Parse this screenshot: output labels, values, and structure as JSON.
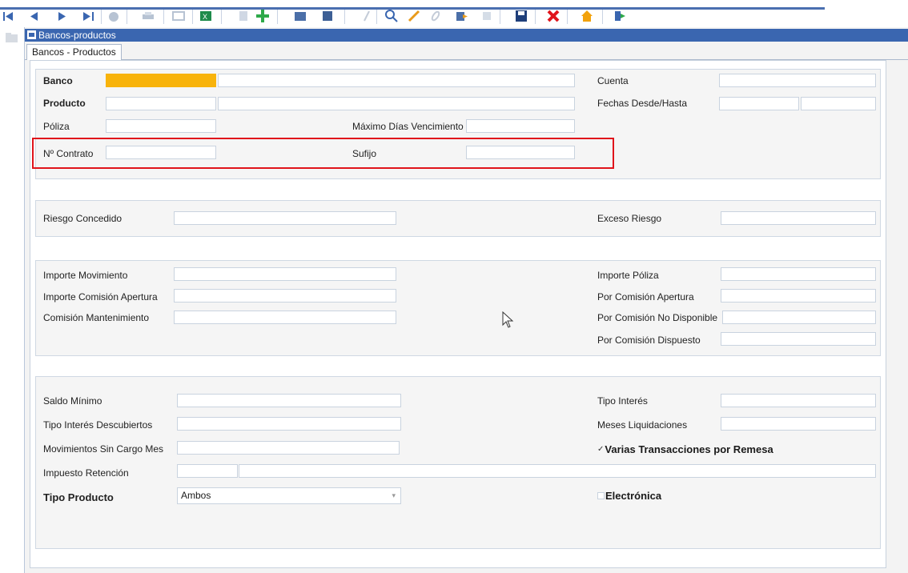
{
  "window": {
    "title": "Bancos-productos",
    "tab": "Bancos - Productos"
  },
  "colors": {
    "title_bar": "#3a66b0",
    "required_field": "#f8b30b",
    "highlight": "#e0141b"
  },
  "toolbar": {
    "icons": [
      "first-record-icon",
      "prev-record-icon",
      "next-record-icon",
      "last-record-icon",
      "chart-icon",
      "print-icon",
      "preview-icon",
      "excel-icon",
      "copy-icon",
      "add-icon",
      "save-list-icon",
      "book-icon",
      "filter-icon",
      "search-icon",
      "edit-icon",
      "link-icon",
      "export-icon",
      "refresh-icon",
      "save-icon",
      "delete-icon",
      "home-icon",
      "exit-icon"
    ]
  },
  "section1": {
    "banco": "Banco",
    "producto": "Producto",
    "poliza": "Póliza",
    "maximo_dias": "Máximo Días Vencimiento",
    "contrato": "Nº Contrato",
    "sufijo": "Sufijo",
    "cuenta": "Cuenta",
    "fechas": "Fechas Desde/Hasta"
  },
  "section2": {
    "riesgo_concedido": "Riesgo Concedido",
    "exceso_riesgo": "Exceso Riesgo"
  },
  "section3": {
    "importe_movimiento": "Importe Movimiento",
    "importe_comision_apertura": "Importe Comisión Apertura",
    "comision_mantenimiento": "Comisión Mantenimiento",
    "importe_poliza": "Importe Póliza",
    "por_comision_apertura": "Por Comisión Apertura",
    "por_comision_no_disponible": "Por Comisión No Disponible",
    "por_comision_dispuesto": "Por Comisión Dispuesto"
  },
  "section4": {
    "saldo_minimo": "Saldo Mínimo",
    "tipo_interes_descubiertos": "Tipo Interés Descubiertos",
    "movimientos_sin_cargo": "Movimientos Sin Cargo Mes",
    "impuesto_retencion": "Impuesto Retención",
    "tipo_producto": "Tipo Producto",
    "tipo_producto_value": "Ambos",
    "tipo_interes": "Tipo Interés",
    "meses_liquidaciones": "Meses Liquidaciones",
    "varias_transacciones": "Varias Transacciones por Remesa",
    "varias_transacciones_checked": true,
    "electronica": "Electrónica",
    "electronica_checked": false
  }
}
